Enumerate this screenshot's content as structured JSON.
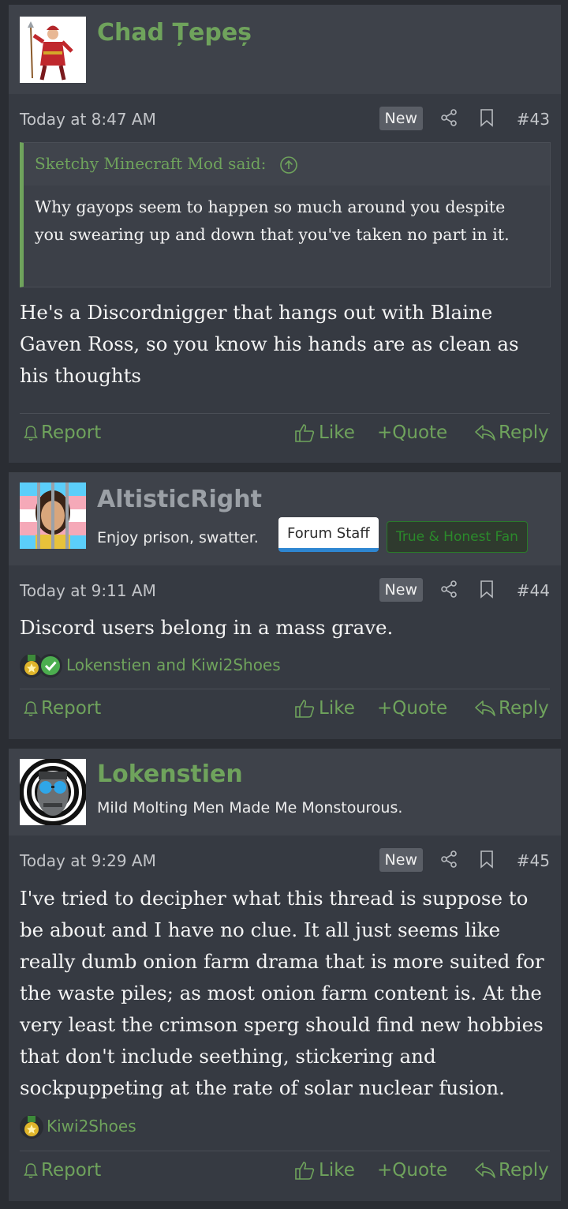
{
  "colors": {
    "page_bg": "#2a2d33",
    "post_bg": "#363a42",
    "accent_green": "#6fa35c",
    "staff_blue": "#2e86d1"
  },
  "actions": {
    "report": "Report",
    "like": "Like",
    "quote": "+Quote",
    "reply": "Reply"
  },
  "posts": [
    {
      "username": "Chad Țepeș",
      "date": "Today at 8:47 AM",
      "new_badge": "New",
      "number": "#43",
      "quote": {
        "author": "Sketchy Minecraft Mod said:",
        "text": "Why gayops seem to happen so much around you despite you swearing up and down that you've taken no part in it."
      },
      "message": "He's a Discordnigger that hangs out with Blaine Gaven Ross, so you know his hands are as clean as his thoughts"
    },
    {
      "username": "AltisticRight",
      "user_title": "Enjoy prison, swatter.",
      "banners": [
        "Forum Staff",
        "True & Honest Fan"
      ],
      "date": "Today at 9:11 AM",
      "new_badge": "New",
      "number": "#44",
      "message": "Discord users belong in a mass grave.",
      "reactions": {
        "icons": [
          "winner-icon",
          "checkmark-icon"
        ],
        "users": "Lokenstien and Kiwi2Shoes"
      }
    },
    {
      "username": "Lokenstien",
      "user_title": "Mild Molting Men Made Me Monstourous.",
      "date": "Today at 9:29 AM",
      "new_badge": "New",
      "number": "#45",
      "message": "I've tried to decipher what this thread is suppose to be about and I have no clue. It all just seems like really dumb onion farm drama that is more suited for the waste piles; as most onion farm content is. At the very least the crimson sperg should find new hobbies that don't include seething, stickering and sockpuppeting at the rate of solar nuclear fusion.",
      "reactions": {
        "icons": [
          "winner-icon"
        ],
        "users": "Kiwi2Shoes"
      }
    }
  ]
}
